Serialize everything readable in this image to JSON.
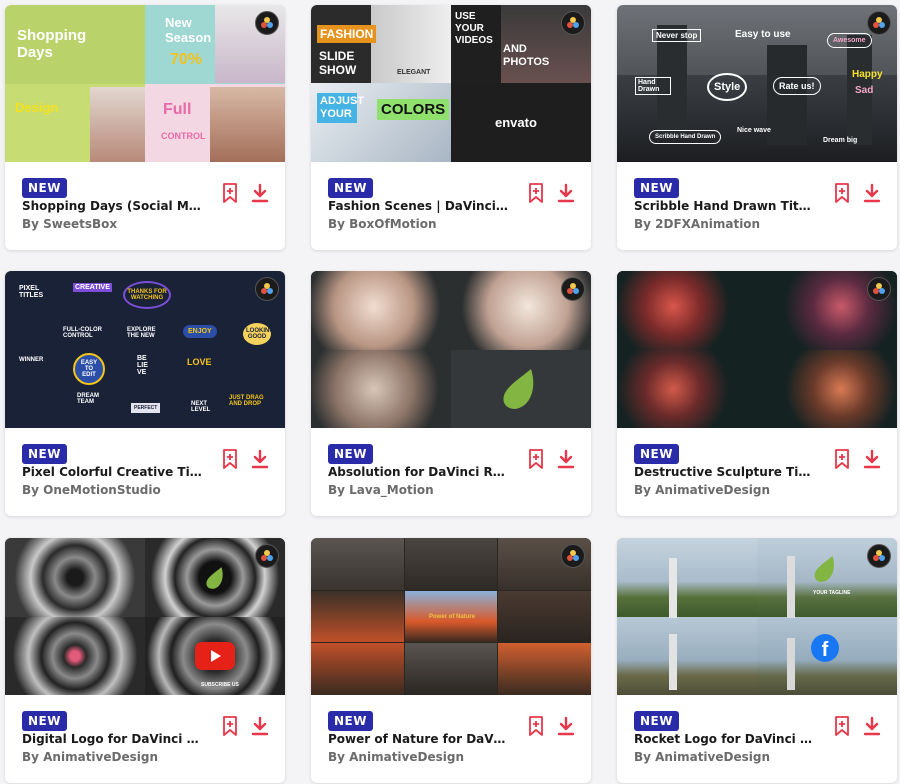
{
  "accent_color": "#e8374a",
  "badge_color": "#2a2ba8",
  "cards": [
    {
      "badge": "NEW",
      "title": "Shopping Days (Social Media...",
      "author": "By SweetsBox",
      "thumb_texts": [
        "Shopping Days",
        "New Season",
        "70%",
        "Design",
        "Full",
        "CONTROL"
      ]
    },
    {
      "badge": "NEW",
      "title": "Fashion Scenes | DaVinci Reso...",
      "author": "By BoxOfMotion",
      "thumb_texts": [
        "FASHION",
        "SLIDE SHOW",
        "ELEGANT",
        "USE YOUR VIDEOS",
        "AND PHOTOS",
        "ADJUST YOUR",
        "COLORS",
        "envato"
      ]
    },
    {
      "badge": "NEW",
      "title": "Scribble Hand Drawn Titles f...",
      "author": "By 2DFXAnimation",
      "thumb_texts": [
        "Never stop",
        "Easy to use",
        "Awesome",
        "Hand Drawn",
        "Style",
        "Rate us!",
        "Happy",
        "Sad",
        "Nice wave",
        "Scribble Hand Drawn",
        "Dream big"
      ]
    },
    {
      "badge": "NEW",
      "title": "Pixel Colorful Creative Titles f...",
      "author": "By OneMotionStudio",
      "thumb_texts": [
        "PIXEL TITLES",
        "CREATIVE",
        "THANKS FOR WATCHING",
        "FULL-COLOR CONTROL",
        "EXPLORE THE NEW",
        "ENJOY",
        "LOOKING GOOD",
        "WINNER",
        "EASY TO EDIT",
        "BE LIE VE",
        "LOVE",
        "DREAM TEAM",
        "PERFECT",
        "NEXT LEVEL",
        "JUST DRAG AND DROP"
      ]
    },
    {
      "badge": "NEW",
      "title": "Absolution for DaVinci Resolve",
      "author": "By Lava_Motion",
      "thumb_texts": []
    },
    {
      "badge": "NEW",
      "title": "Destructive Sculpture Titles f...",
      "author": "By AnimativeDesign",
      "thumb_texts": []
    },
    {
      "badge": "NEW",
      "title": "Digital Logo for DaVinci Reso...",
      "author": "By AnimativeDesign",
      "thumb_texts": [
        "SUBSCRIBE US"
      ]
    },
    {
      "badge": "NEW",
      "title": "Power of Nature for DaVinci ...",
      "author": "By AnimativeDesign",
      "thumb_texts": [
        "Power of Nature"
      ]
    },
    {
      "badge": "NEW",
      "title": "Rocket Logo for DaVinci Reso...",
      "author": "By AnimativeDesign",
      "thumb_texts": [
        "YOUR TAGLINE"
      ]
    }
  ]
}
